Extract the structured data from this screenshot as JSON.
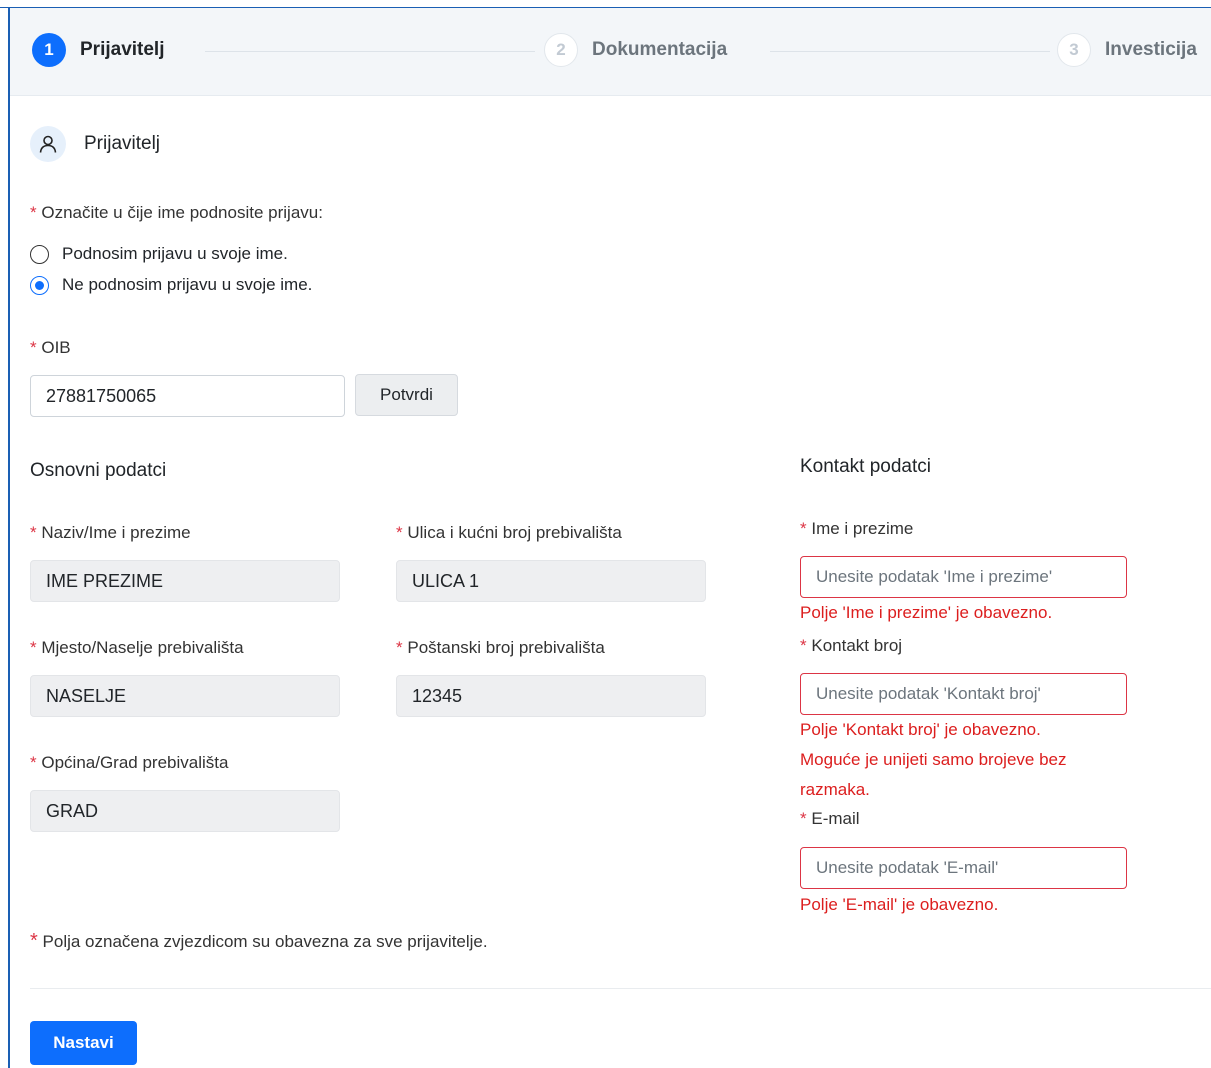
{
  "stepper": {
    "steps": [
      {
        "number": "1",
        "label": "Prijavitelj",
        "active": true
      },
      {
        "number": "2",
        "label": "Dokumentacija",
        "active": false
      },
      {
        "number": "3",
        "label": "Investicija",
        "active": false
      }
    ]
  },
  "section": {
    "title": "Prijavitelj"
  },
  "applicant_type": {
    "required_mark": "*",
    "label": "Označite u čije ime podnosite prijavu:",
    "options": [
      {
        "label": "Podnosim prijavu u svoje ime.",
        "selected": false
      },
      {
        "label": "Ne podnosim prijavu u svoje ime.",
        "selected": true
      }
    ]
  },
  "oib": {
    "label": "OIB",
    "value": "27881750065",
    "confirm_label": "Potvrdi"
  },
  "basic": {
    "title": "Osnovni podatci",
    "name": {
      "label": "Naziv/Ime i prezime",
      "value": "IME PREZIME"
    },
    "street": {
      "label": "Ulica i kućni broj prebivališta",
      "value": "ULICA 1"
    },
    "place": {
      "label": "Mjesto/Naselje prebivališta",
      "value": "NASELJE"
    },
    "postal": {
      "label": "Poštanski broj prebivališta",
      "value": "12345"
    },
    "municipality": {
      "label": "Općina/Grad prebivališta",
      "value": "GRAD"
    }
  },
  "contact": {
    "title": "Kontakt podatci",
    "name": {
      "label": "Ime i prezime",
      "placeholder": "Unesite podatak 'Ime i prezime'",
      "error": "Polje 'Ime i prezime' je obavezno."
    },
    "phone": {
      "label": "Kontakt broj",
      "placeholder": "Unesite podatak 'Kontakt broj'",
      "error": "Polje 'Kontakt broj' je obavezno.",
      "error2_line1": "Moguće je unijeti samo brojeve bez",
      "error2_line2": "razmaka."
    },
    "email": {
      "label": "E-mail",
      "placeholder": "Unesite podatak 'E-mail'",
      "error": "Polje 'E-mail' je obavezno."
    }
  },
  "footer": {
    "note": "Polja označena zvjezdicom su obavezna za sve prijavitelje.",
    "continue_label": "Nastavi"
  },
  "colors": {
    "primary": "#0d6efd",
    "error": "#dc1e1e",
    "required": "#dc3545"
  }
}
